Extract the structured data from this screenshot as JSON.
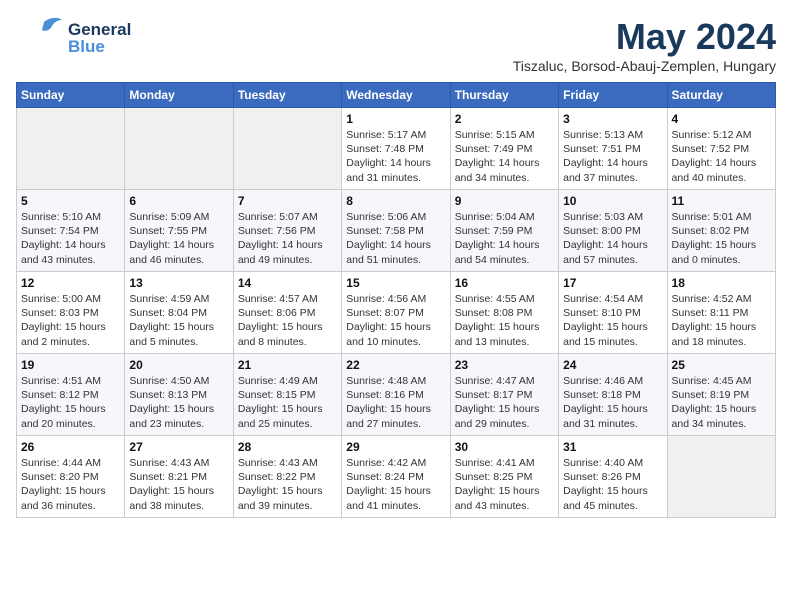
{
  "header": {
    "logo": {
      "general": "General",
      "blue": "Blue"
    },
    "month": "May 2024",
    "location": "Tiszaluc, Borsod-Abauj-Zemplen, Hungary"
  },
  "columns": [
    "Sunday",
    "Monday",
    "Tuesday",
    "Wednesday",
    "Thursday",
    "Friday",
    "Saturday"
  ],
  "weeks": [
    [
      {
        "day": "",
        "info": ""
      },
      {
        "day": "",
        "info": ""
      },
      {
        "day": "",
        "info": ""
      },
      {
        "day": "1",
        "info": "Sunrise: 5:17 AM\nSunset: 7:48 PM\nDaylight: 14 hours\nand 31 minutes."
      },
      {
        "day": "2",
        "info": "Sunrise: 5:15 AM\nSunset: 7:49 PM\nDaylight: 14 hours\nand 34 minutes."
      },
      {
        "day": "3",
        "info": "Sunrise: 5:13 AM\nSunset: 7:51 PM\nDaylight: 14 hours\nand 37 minutes."
      },
      {
        "day": "4",
        "info": "Sunrise: 5:12 AM\nSunset: 7:52 PM\nDaylight: 14 hours\nand 40 minutes."
      }
    ],
    [
      {
        "day": "5",
        "info": "Sunrise: 5:10 AM\nSunset: 7:54 PM\nDaylight: 14 hours\nand 43 minutes."
      },
      {
        "day": "6",
        "info": "Sunrise: 5:09 AM\nSunset: 7:55 PM\nDaylight: 14 hours\nand 46 minutes."
      },
      {
        "day": "7",
        "info": "Sunrise: 5:07 AM\nSunset: 7:56 PM\nDaylight: 14 hours\nand 49 minutes."
      },
      {
        "day": "8",
        "info": "Sunrise: 5:06 AM\nSunset: 7:58 PM\nDaylight: 14 hours\nand 51 minutes."
      },
      {
        "day": "9",
        "info": "Sunrise: 5:04 AM\nSunset: 7:59 PM\nDaylight: 14 hours\nand 54 minutes."
      },
      {
        "day": "10",
        "info": "Sunrise: 5:03 AM\nSunset: 8:00 PM\nDaylight: 14 hours\nand 57 minutes."
      },
      {
        "day": "11",
        "info": "Sunrise: 5:01 AM\nSunset: 8:02 PM\nDaylight: 15 hours\nand 0 minutes."
      }
    ],
    [
      {
        "day": "12",
        "info": "Sunrise: 5:00 AM\nSunset: 8:03 PM\nDaylight: 15 hours\nand 2 minutes."
      },
      {
        "day": "13",
        "info": "Sunrise: 4:59 AM\nSunset: 8:04 PM\nDaylight: 15 hours\nand 5 minutes."
      },
      {
        "day": "14",
        "info": "Sunrise: 4:57 AM\nSunset: 8:06 PM\nDaylight: 15 hours\nand 8 minutes."
      },
      {
        "day": "15",
        "info": "Sunrise: 4:56 AM\nSunset: 8:07 PM\nDaylight: 15 hours\nand 10 minutes."
      },
      {
        "day": "16",
        "info": "Sunrise: 4:55 AM\nSunset: 8:08 PM\nDaylight: 15 hours\nand 13 minutes."
      },
      {
        "day": "17",
        "info": "Sunrise: 4:54 AM\nSunset: 8:10 PM\nDaylight: 15 hours\nand 15 minutes."
      },
      {
        "day": "18",
        "info": "Sunrise: 4:52 AM\nSunset: 8:11 PM\nDaylight: 15 hours\nand 18 minutes."
      }
    ],
    [
      {
        "day": "19",
        "info": "Sunrise: 4:51 AM\nSunset: 8:12 PM\nDaylight: 15 hours\nand 20 minutes."
      },
      {
        "day": "20",
        "info": "Sunrise: 4:50 AM\nSunset: 8:13 PM\nDaylight: 15 hours\nand 23 minutes."
      },
      {
        "day": "21",
        "info": "Sunrise: 4:49 AM\nSunset: 8:15 PM\nDaylight: 15 hours\nand 25 minutes."
      },
      {
        "day": "22",
        "info": "Sunrise: 4:48 AM\nSunset: 8:16 PM\nDaylight: 15 hours\nand 27 minutes."
      },
      {
        "day": "23",
        "info": "Sunrise: 4:47 AM\nSunset: 8:17 PM\nDaylight: 15 hours\nand 29 minutes."
      },
      {
        "day": "24",
        "info": "Sunrise: 4:46 AM\nSunset: 8:18 PM\nDaylight: 15 hours\nand 31 minutes."
      },
      {
        "day": "25",
        "info": "Sunrise: 4:45 AM\nSunset: 8:19 PM\nDaylight: 15 hours\nand 34 minutes."
      }
    ],
    [
      {
        "day": "26",
        "info": "Sunrise: 4:44 AM\nSunset: 8:20 PM\nDaylight: 15 hours\nand 36 minutes."
      },
      {
        "day": "27",
        "info": "Sunrise: 4:43 AM\nSunset: 8:21 PM\nDaylight: 15 hours\nand 38 minutes."
      },
      {
        "day": "28",
        "info": "Sunrise: 4:43 AM\nSunset: 8:22 PM\nDaylight: 15 hours\nand 39 minutes."
      },
      {
        "day": "29",
        "info": "Sunrise: 4:42 AM\nSunset: 8:24 PM\nDaylight: 15 hours\nand 41 minutes."
      },
      {
        "day": "30",
        "info": "Sunrise: 4:41 AM\nSunset: 8:25 PM\nDaylight: 15 hours\nand 43 minutes."
      },
      {
        "day": "31",
        "info": "Sunrise: 4:40 AM\nSunset: 8:26 PM\nDaylight: 15 hours\nand 45 minutes."
      },
      {
        "day": "",
        "info": ""
      }
    ]
  ]
}
